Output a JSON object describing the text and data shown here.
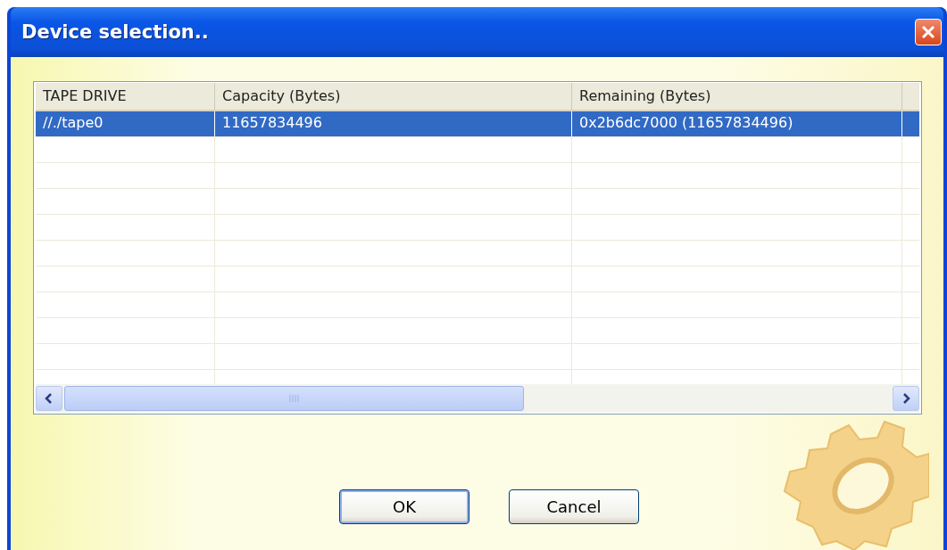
{
  "window": {
    "title": "Device selection.."
  },
  "table": {
    "columns": [
      "TAPE DRIVE",
      "Capacity (Bytes)",
      "Remaining (Bytes)"
    ],
    "rows": [
      {
        "cells": [
          "//./tape0",
          "11657834496",
          "0x2b6dc7000 (11657834496)"
        ],
        "selected": true
      }
    ]
  },
  "buttons": [
    {
      "label": "OK",
      "default": true
    },
    {
      "label": "Cancel",
      "default": false
    }
  ]
}
